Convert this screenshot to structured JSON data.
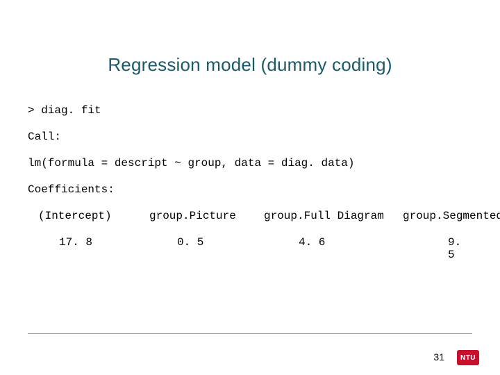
{
  "title": "Regression model (dummy coding)",
  "code": {
    "line1": "> diag. fit",
    "line2": "Call:",
    "line3": "lm(formula = descript ~ group, data = diag. data)",
    "line4": "Coefficients:"
  },
  "coefficients": {
    "headers": {
      "c1": "(Intercept)",
      "c2": "group.Picture",
      "c3": "group.Full Diagram",
      "c4": "group.Segmented"
    },
    "values": {
      "v1": "17. 8",
      "v2": "0. 5",
      "v3": "4. 6",
      "v4": "9. 5"
    }
  },
  "page_number": "31",
  "logo_text": "NTU"
}
